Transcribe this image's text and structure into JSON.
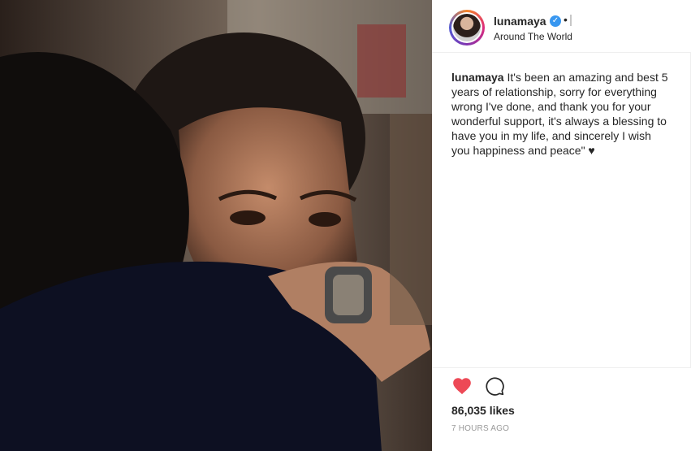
{
  "post": {
    "username": "lunamaya",
    "location": "Around The World",
    "separator": "•",
    "caption_user": "lunamaya",
    "caption_text": " It's been an amazing and best 5 years of relationship, sorry for everything wrong I've done, and thank you for your wonderful support, it's always a blessing to have you in my life, and sincerely I wish you happiness and peace\" ♥",
    "likes": "86,035 likes",
    "time": "7 HOURS AGO"
  },
  "colors": {
    "like_red": "#ed4956",
    "verified_blue": "#3897f0",
    "muted": "#999999"
  },
  "icons": {
    "like": "heart-icon",
    "comment": "comment-icon",
    "verified": "verified-badge-icon"
  }
}
